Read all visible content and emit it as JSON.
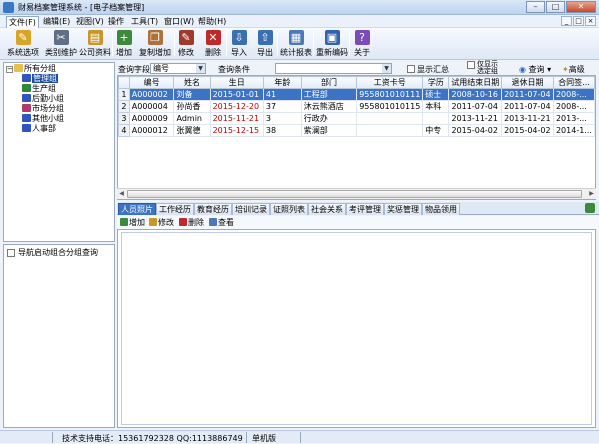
{
  "window": {
    "title": "财易档案管理系统 - [电子档案管理]",
    "min": "–",
    "max": "□",
    "close": "✕"
  },
  "menu": [
    "文件(F)",
    "编辑(E)",
    "视图(V)",
    "操作",
    "工具(T)",
    "窗口(W)",
    "帮助(H)"
  ],
  "mdi": [
    "_",
    "□",
    "×"
  ],
  "toolbar": [
    {
      "label": "系统选项",
      "icon": "system-options-icon",
      "glyph": "✎",
      "color": "#d9a526"
    },
    {
      "label": "类别维护",
      "icon": "category-icon",
      "glyph": "✂",
      "color": "#5e6f86"
    },
    {
      "label": "公司资料",
      "icon": "company-icon",
      "glyph": "▤",
      "color": "#c9962a"
    },
    {
      "label": "增加",
      "icon": "add-icon",
      "glyph": "+",
      "color": "#3c8a3a"
    },
    {
      "label": "复制增加",
      "icon": "copy-add-icon",
      "glyph": "❐",
      "color": "#b0703a"
    },
    {
      "label": "修改",
      "icon": "edit-icon",
      "glyph": "✎",
      "color": "#a03a2a"
    },
    {
      "label": "删除",
      "icon": "delete-icon",
      "glyph": "✕",
      "color": "#c0282a"
    },
    {
      "label": "导入",
      "icon": "import-icon",
      "glyph": "⇩",
      "color": "#3a6fb0"
    },
    {
      "label": "导出",
      "icon": "export-icon",
      "glyph": "⇧",
      "color": "#3a6fb0"
    },
    {
      "label": "统计报表",
      "icon": "report-icon",
      "glyph": "▦",
      "color": "#4d79b8"
    },
    {
      "label": "重新编码",
      "icon": "recode-icon",
      "glyph": "▣",
      "color": "#3063b0"
    },
    {
      "label": "关于",
      "icon": "about-icon",
      "glyph": "?",
      "color": "#7b4cb8"
    }
  ],
  "tree": {
    "root": "所有分组",
    "children": [
      {
        "label": "管理组",
        "color": "#2e55c0"
      },
      {
        "label": "生产组",
        "color": "#2a8a3a"
      },
      {
        "label": "后勤小组",
        "color": "#2e55c0"
      },
      {
        "label": "市场分组",
        "color": "#b03a6a"
      },
      {
        "label": "其他小组",
        "color": "#2e55c0"
      },
      {
        "label": "人事部",
        "color": "#2e55c0"
      }
    ]
  },
  "nav_option": "导航启动组合分组查询",
  "filter": {
    "field_label": "查询字段",
    "field_value": "编号",
    "cond_label": "查询条件",
    "cond_value": "",
    "show_summary": "显示汇总",
    "only_show_line1": "仅显示",
    "only_show_line2": "选定组",
    "query": "查询",
    "advanced": "高级"
  },
  "table": {
    "columns": [
      "编号",
      "姓名",
      "生日",
      "年龄",
      "部门",
      "工资卡号",
      "学历",
      "试用结束日期",
      "退休日期",
      "合同签..."
    ],
    "rows": [
      {
        "n": "1",
        "cells": [
          "A000002",
          "刘备",
          "2015-01-01",
          "41",
          "工程部",
          "955801010111",
          "硕士",
          "2008-10-16",
          "2011-07-04",
          "2008-..."
        ],
        "selected": true
      },
      {
        "n": "2",
        "cells": [
          "A000004",
          "孙尚香",
          "2015-12-20",
          "37",
          "沐云熊酒店",
          "955801010115",
          "本科",
          "2011-07-04",
          "2011-07-04",
          "2008-..."
        ],
        "selected": false
      },
      {
        "n": "3",
        "cells": [
          "A000009",
          "Admin",
          "2015-11-21",
          "3",
          "行政办",
          "",
          "",
          "2013-11-21",
          "2013-11-21",
          "2013-..."
        ],
        "selected": false
      },
      {
        "n": "4",
        "cells": [
          "A000012",
          "张翼德",
          "2015-12-15",
          "38",
          "紫澜部",
          "",
          "中专",
          "2015-04-02",
          "2015-04-02",
          "2014-1..."
        ],
        "selected": false
      }
    ]
  },
  "tabs": [
    "人员照片",
    "工作经历",
    "教育经历",
    "培训记录",
    "证照列表",
    "社会关系",
    "考评管理",
    "奖惩管理",
    "物品领用"
  ],
  "subtoolbar": {
    "add": "增加",
    "edit": "修改",
    "delete": "删除",
    "view": "查看"
  },
  "status": {
    "support": "技术支持电话：15361792328  QQ:1113886749",
    "mode": "单机版"
  }
}
